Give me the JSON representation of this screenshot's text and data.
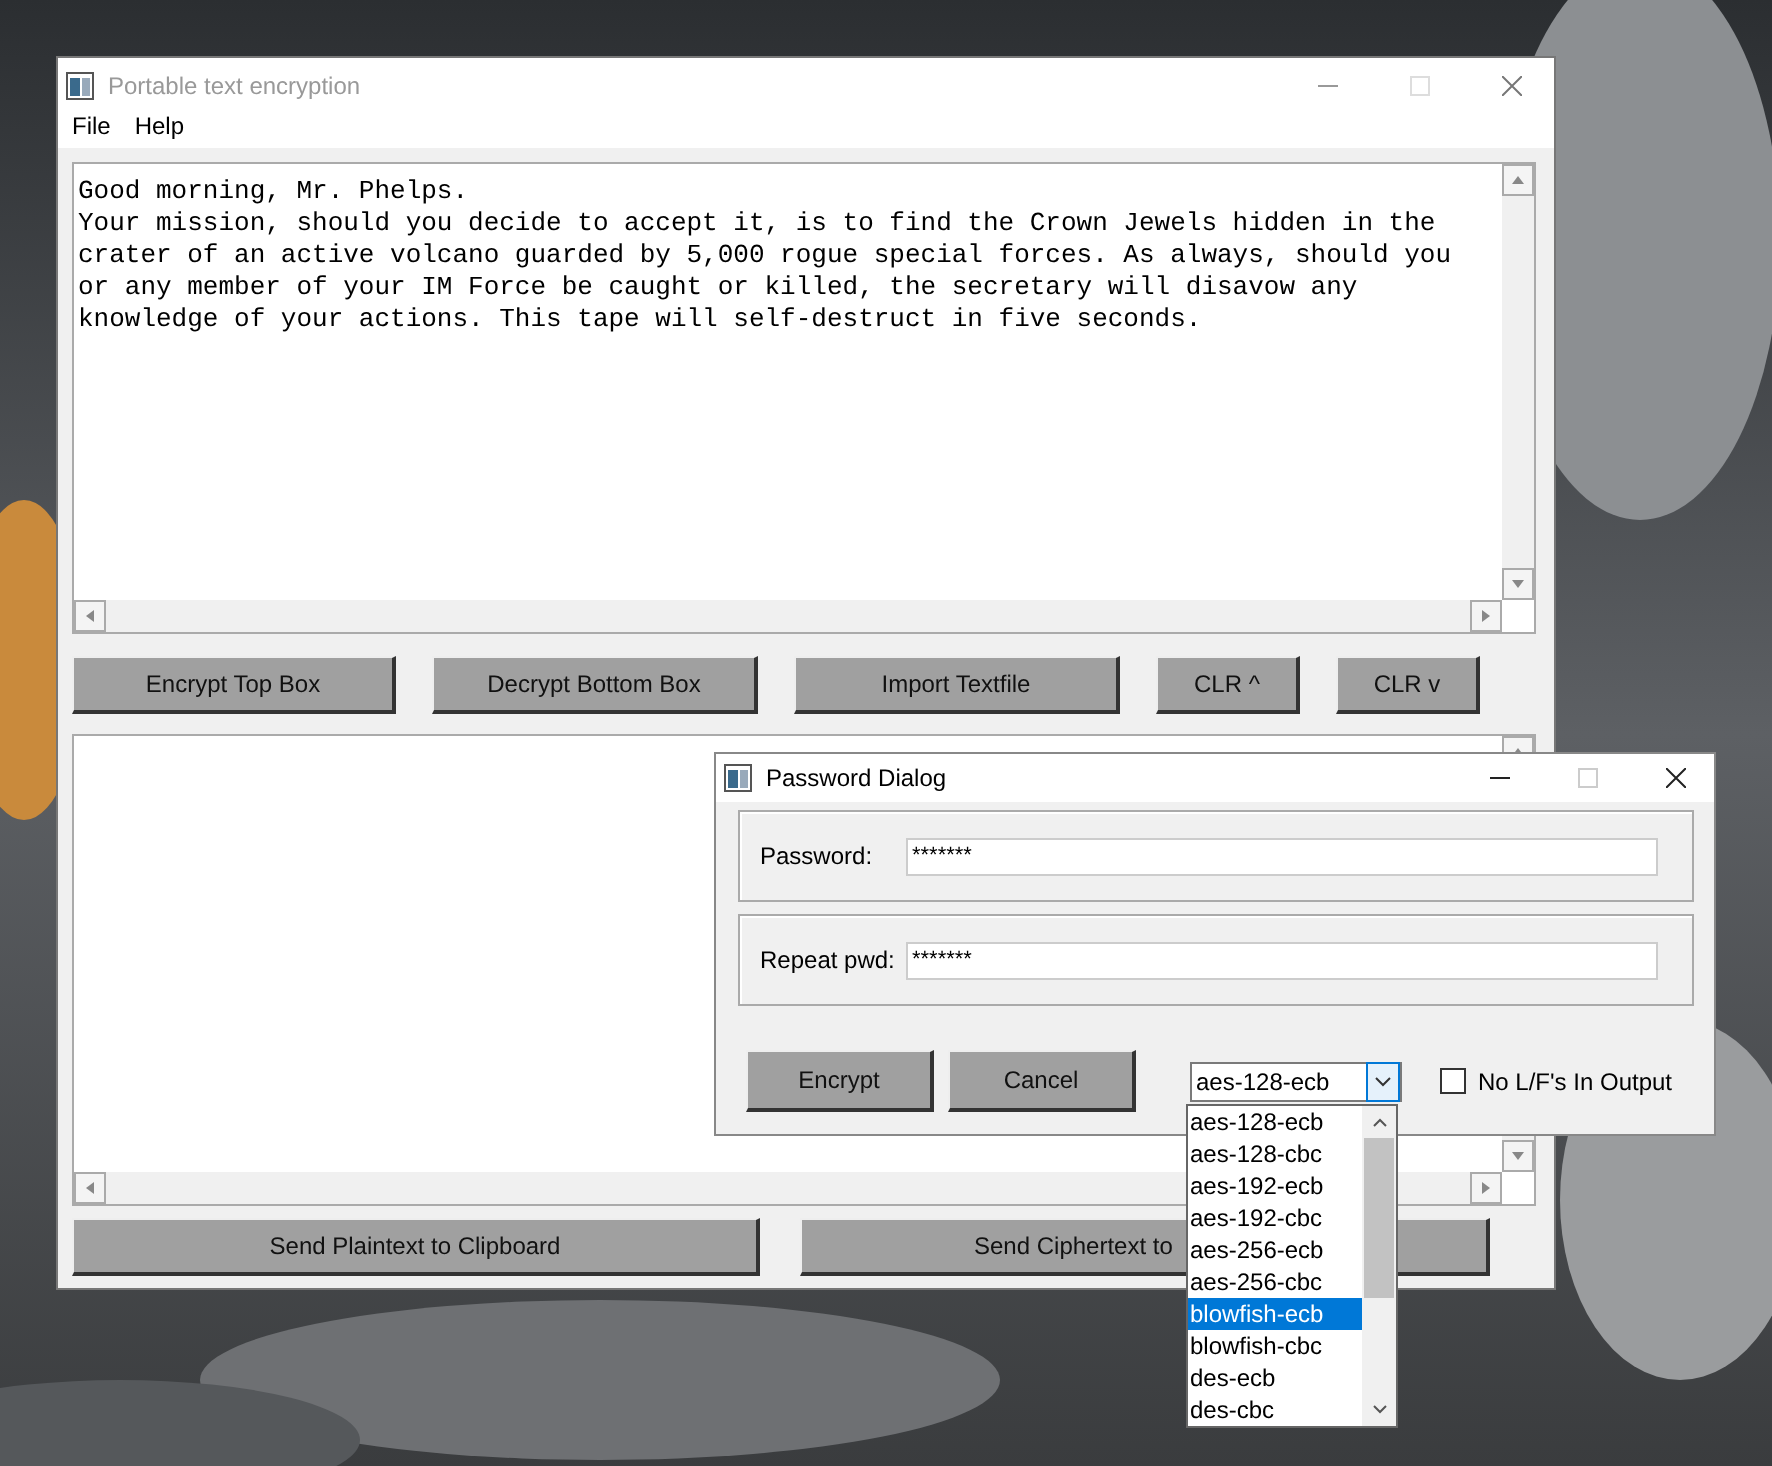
{
  "main_window": {
    "title": "Portable text encryption",
    "menu": [
      "File",
      "Help"
    ],
    "top_text": [
      "Good morning, Mr. Phelps.",
      "Your mission, should you decide to accept it, is to find the Crown Jewels hidden in the",
      "crater of an active volcano guarded by 5,000 rogue special forces. As always, should you",
      "or any member of your IM Force be caught or killed, the secretary will disavow any",
      "knowledge of your actions. This tape will self-destruct in five seconds."
    ],
    "buttons": [
      "Encrypt Top Box",
      "Decrypt Bottom Box",
      "Import Textfile",
      "CLR ^",
      "CLR v"
    ],
    "bottom_buttons": [
      "Send Plaintext to Clipboard",
      "Send Ciphertext to"
    ]
  },
  "dialog": {
    "title": "Password Dialog",
    "fields": [
      {
        "label": "Password:",
        "value": "*******"
      },
      {
        "label": "Repeat pwd:",
        "value": "*******"
      }
    ],
    "buttons": [
      "Encrypt",
      "Cancel"
    ],
    "cipher": {
      "value": "aes-128-ecb",
      "options": [
        {
          "label": "aes-128-ecb",
          "highlighted": false
        },
        {
          "label": "aes-128-cbc",
          "highlighted": false
        },
        {
          "label": "aes-192-ecb",
          "highlighted": false
        },
        {
          "label": "aes-192-cbc",
          "highlighted": false
        },
        {
          "label": "aes-256-ecb",
          "highlighted": false
        },
        {
          "label": "aes-256-cbc",
          "highlighted": false
        },
        {
          "label": "blowfish-ecb",
          "highlighted": true
        },
        {
          "label": "blowfish-cbc",
          "highlighted": false
        },
        {
          "label": "des-ecb",
          "highlighted": false
        },
        {
          "label": "des-cbc",
          "highlighted": false
        }
      ]
    },
    "checkbox": {
      "label": "No L/F's In Output",
      "checked": false
    }
  }
}
